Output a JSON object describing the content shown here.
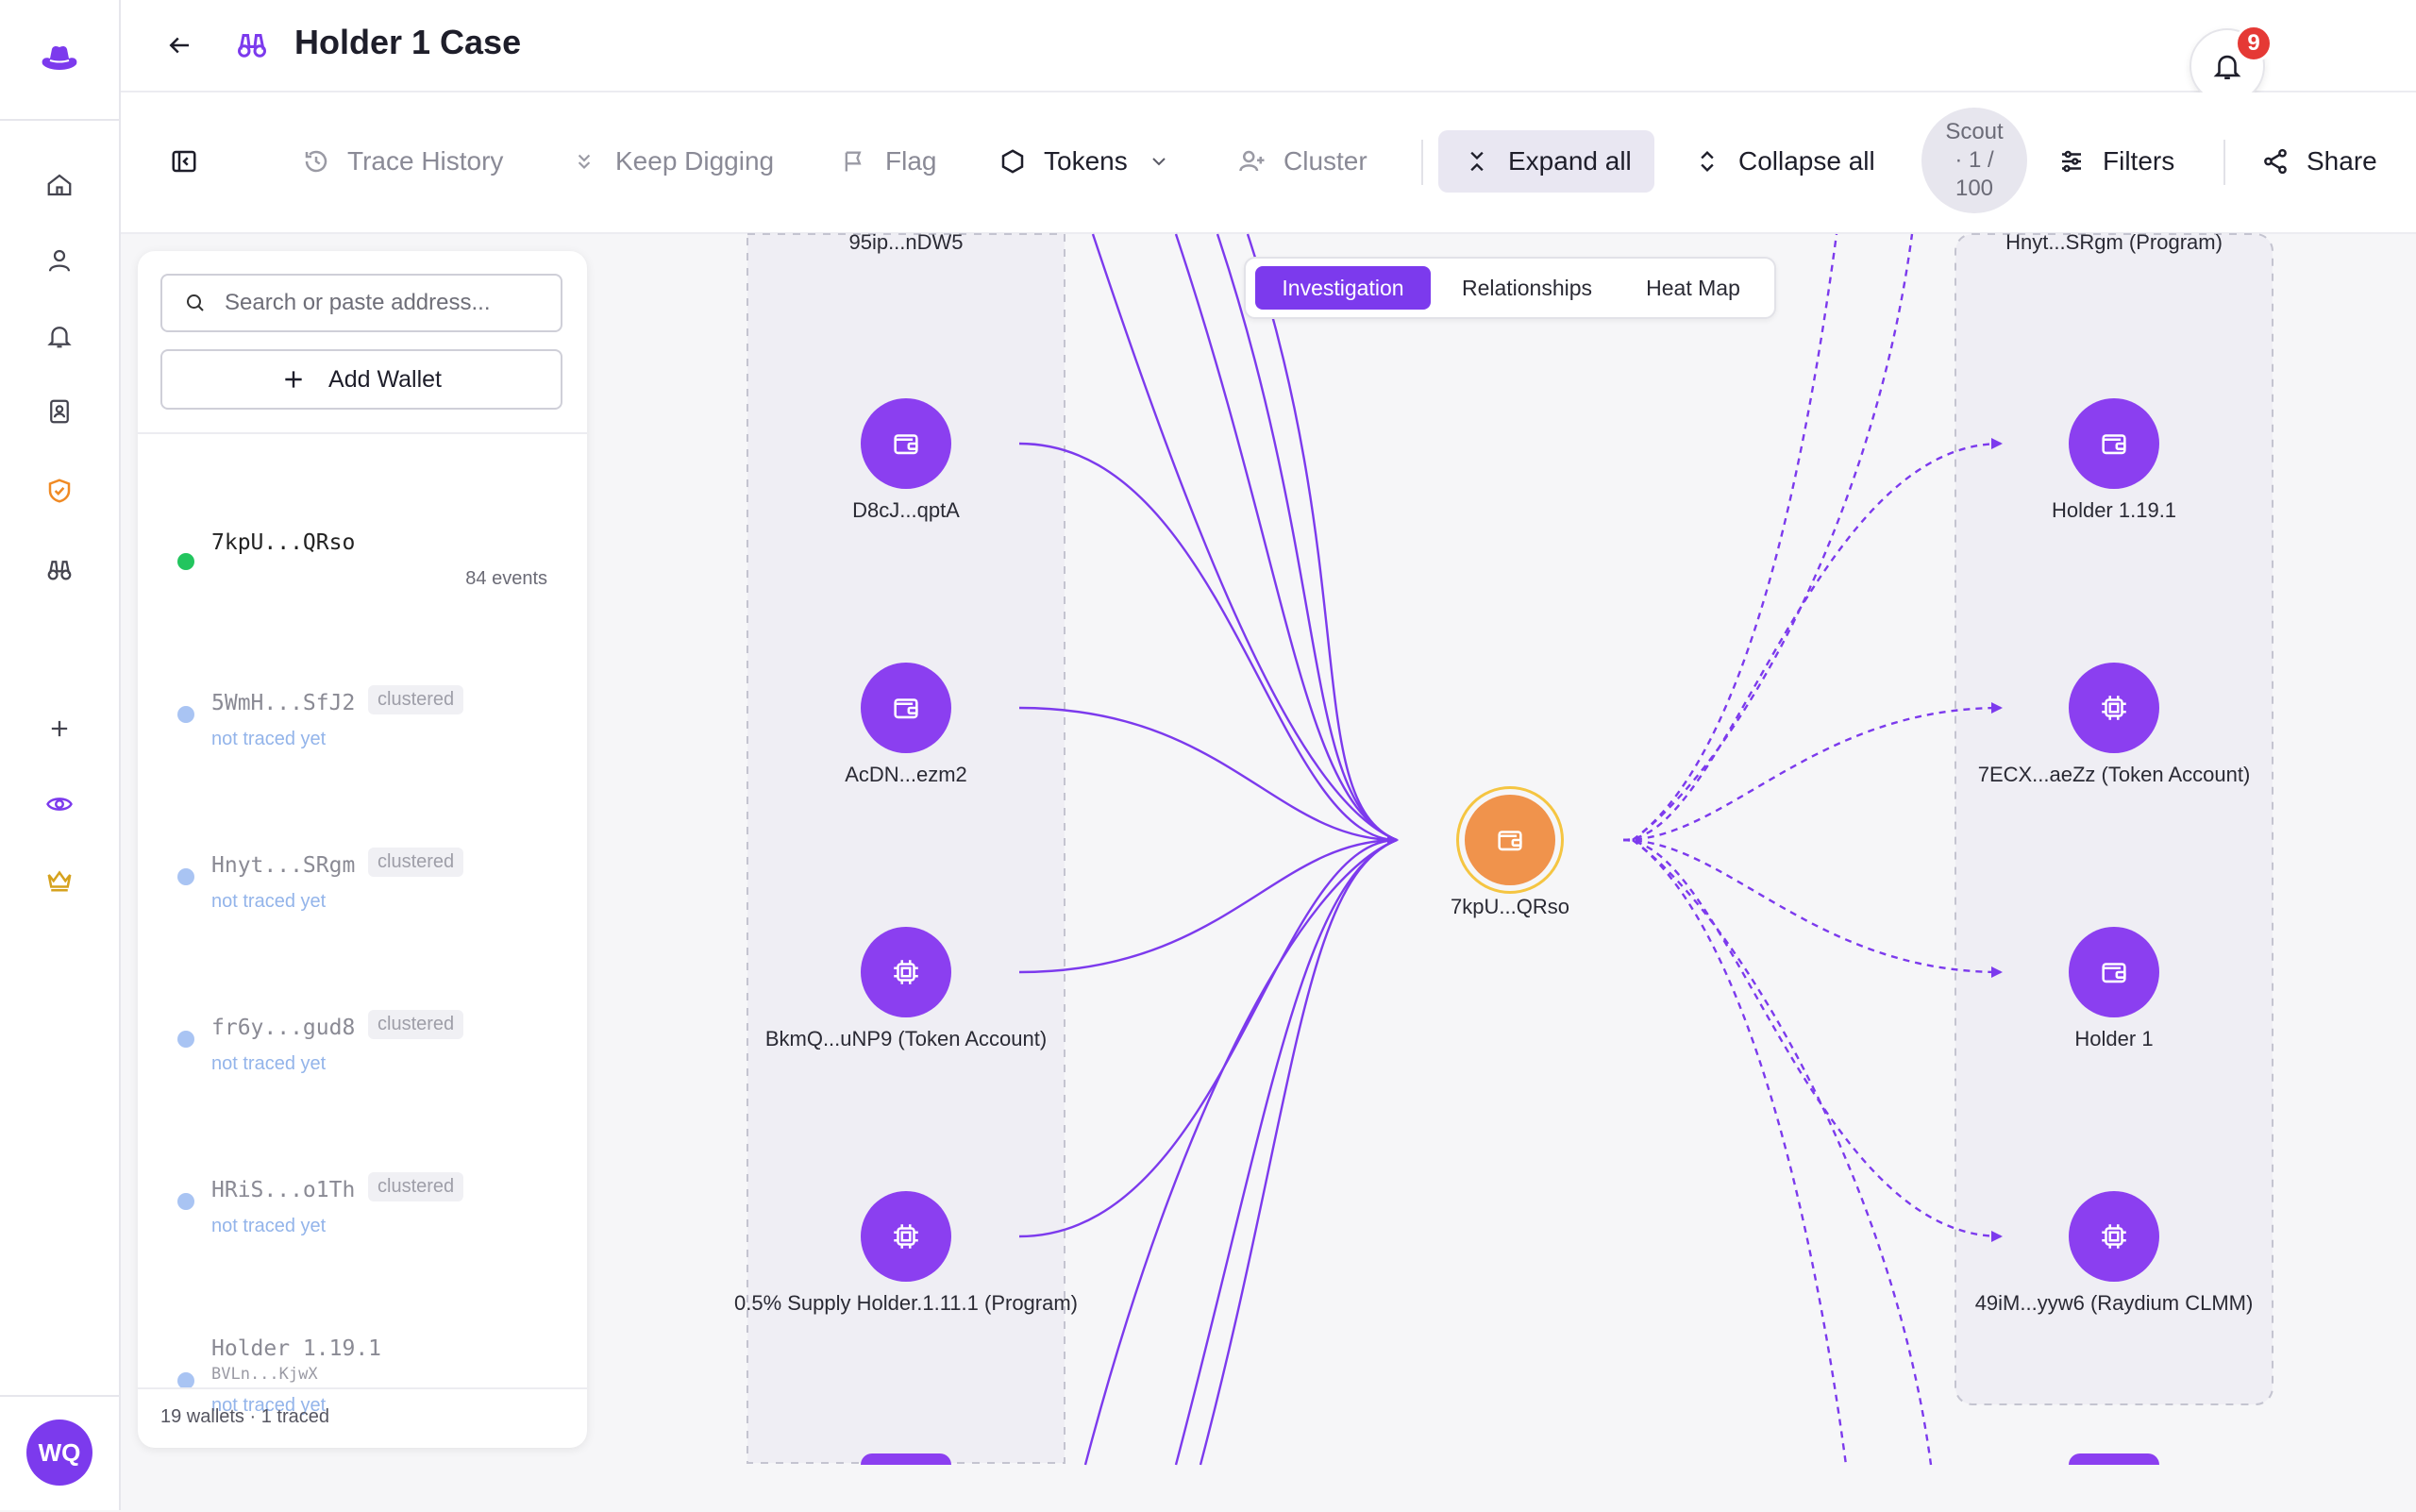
{
  "header": {
    "title": "Holder 1 Case",
    "notification_count": "9"
  },
  "toolbar": {
    "trace_history": "Trace History",
    "keep_digging": "Keep Digging",
    "flag": "Flag",
    "tokens": "Tokens",
    "cluster": "Cluster",
    "expand_all": "Expand all",
    "collapse_all": "Collapse all",
    "scout_line1": "Scout",
    "scout_line2": "· 1 /",
    "scout_line3": "100",
    "filters": "Filters",
    "share": "Share"
  },
  "sidebar_rail": {
    "avatar_initials": "WQ",
    "accent": "#7c3aed",
    "shield_color": "#f08a24",
    "crown_color": "#d6a21e"
  },
  "panel": {
    "search_placeholder": "Search or paste address...",
    "add_wallet": "Add Wallet",
    "wallets": [
      {
        "name": "7kpU...QRso",
        "events": "84 events",
        "status_color": "#22c55e"
      },
      {
        "name": "5WmH...SfJ2",
        "badge": "clustered",
        "status": "not traced yet"
      },
      {
        "name": "Hnyt...SRgm",
        "badge": "clustered",
        "status": "not traced yet"
      },
      {
        "name": "fr6y...gud8",
        "badge": "clustered",
        "status": "not traced yet"
      },
      {
        "name": "HRiS...o1Th",
        "badge": "clustered",
        "status": "not traced yet"
      },
      {
        "name": "Holder 1.19.1",
        "address": "BVLn...KjwX",
        "status": "not traced yet"
      }
    ],
    "footer": "19 wallets · 1 traced"
  },
  "view_tabs": [
    "Investigation",
    "Relationships",
    "Heat Map"
  ],
  "graph": {
    "center": {
      "label": "7kpU...QRso",
      "icon": "wallet-icon"
    },
    "left_top_label": "95ip...nDW5",
    "left_nodes": [
      {
        "label": "D8cJ...qptA",
        "icon": "wallet-icon"
      },
      {
        "label": "AcDN...ezm2",
        "icon": "wallet-icon"
      },
      {
        "label": "BkmQ...uNP9 (Token Account)",
        "icon": "chip-icon"
      },
      {
        "label": "0.5% Supply Holder.1.11.1 (Program)",
        "icon": "chip-icon"
      }
    ],
    "right_top_label": "Hnyt...SRgm (Program)",
    "right_nodes": [
      {
        "label": "Holder 1.19.1",
        "icon": "wallet-icon"
      },
      {
        "label": "7ECX...aeZz (Token Account)",
        "icon": "chip-icon"
      },
      {
        "label": "Holder 1",
        "icon": "wallet-icon"
      },
      {
        "label": "49iM...yyw6 (Raydium CLMM)",
        "icon": "chip-icon"
      }
    ],
    "edge_color": "#7c3aed",
    "center_color": "#f0934c"
  }
}
